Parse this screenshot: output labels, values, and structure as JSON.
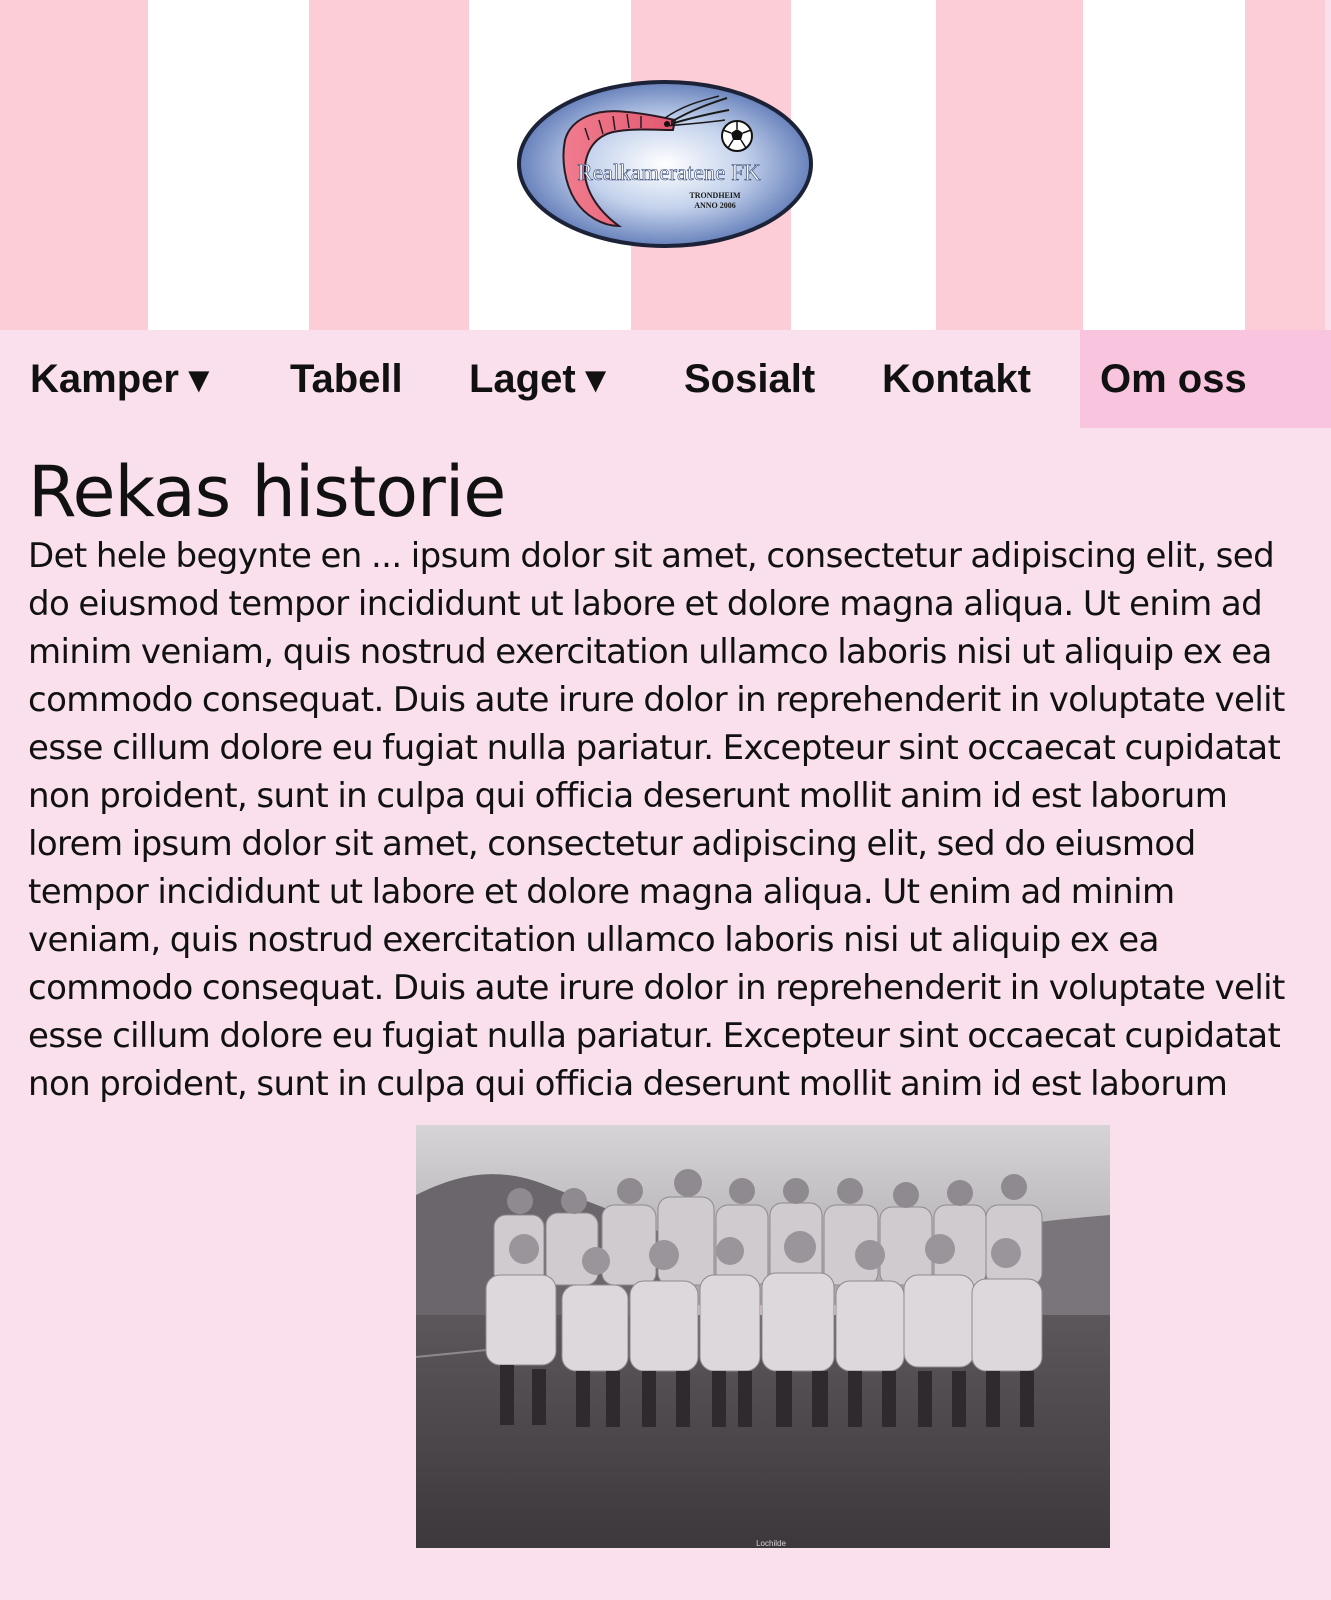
{
  "header": {
    "logo": {
      "club_name": "Realkameratene FK",
      "city": "TRONDHEIM",
      "founded": "ANNO 2006",
      "icon": "shrimp-football-crest"
    },
    "colors": {
      "stripe_pink": "#fdcdd7",
      "stripe_white": "#ffffff",
      "page_background": "#f9e0ec",
      "active_nav_background": "#f8c4de"
    }
  },
  "nav": {
    "items": [
      {
        "label": "Kamper",
        "has_dropdown": true
      },
      {
        "label": "Tabell",
        "has_dropdown": false
      },
      {
        "label": "Laget",
        "has_dropdown": true
      },
      {
        "label": "Sosialt",
        "has_dropdown": false
      },
      {
        "label": "Kontakt",
        "has_dropdown": false
      },
      {
        "label": "Om oss",
        "has_dropdown": false,
        "active": true
      }
    ],
    "dropdown_caret": "▼"
  },
  "main": {
    "title": "Rekas historie",
    "body": "Det hele begynte en ... ipsum dolor sit amet, consectetur adipiscing elit, sed do eiusmod tempor incididunt ut labore et dolore magna aliqua. Ut enim ad minim veniam, quis nostrud exercitation ullamco laboris nisi ut aliquip ex ea commodo consequat. Duis aute irure dolor in reprehenderit in voluptate velit esse cillum dolore eu fugiat nulla pariatur. Excepteur sint occaecat cupidatat non proident, sunt in culpa qui officia deserunt mollit anim id est laborum lorem ipsum dolor sit amet, consectetur adipiscing elit, sed do eiusmod tempor incididunt ut labore et dolore magna aliqua. Ut enim ad minim veniam, quis nostrud exercitation ullamco laboris nisi ut aliquip ex ea commodo consequat. Duis aute irure dolor in reprehenderit in voluptate velit esse cillum dolore eu fugiat nulla pariatur. Excepteur sint occaecat cupidatat non proident, sunt in culpa qui officia deserunt mollit anim id est laborum",
    "photo": {
      "subject": "team-photo",
      "caption": "Lochilde"
    }
  }
}
